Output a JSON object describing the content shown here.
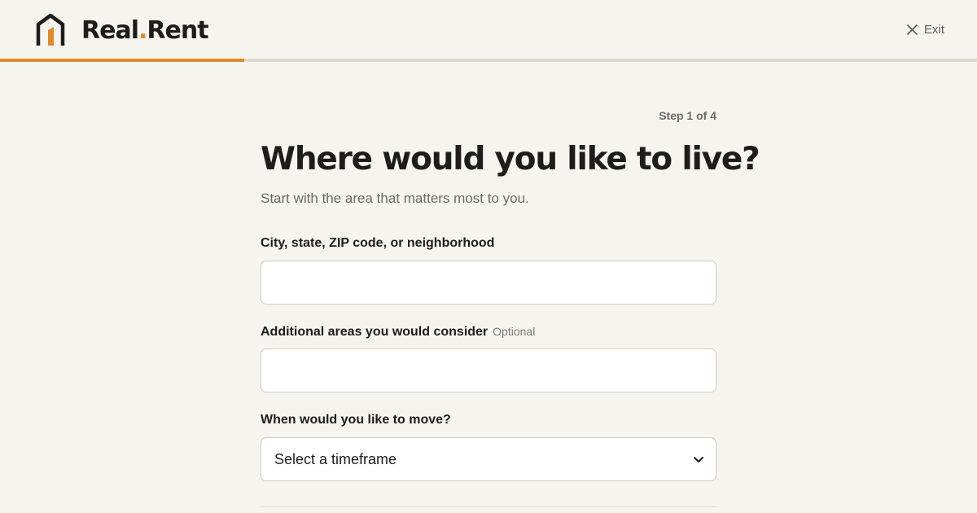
{
  "brand": {
    "name_part1": "Real",
    "name_dot": ".",
    "name_part2": "Rent",
    "accent_color": "#e08a2c"
  },
  "header": {
    "exit_label": "Exit",
    "exit_icon": "close-icon",
    "progress_fraction": 0.25
  },
  "step_indicator": "Step 1 of 4",
  "title": "Where would you like to live?",
  "subtitle": "Start with the area that matters most to you.",
  "fields": {
    "location": {
      "label": "City, state, ZIP code, or neighborhood",
      "value": "",
      "placeholder": ""
    },
    "additional_areas": {
      "label": "Additional areas you would consider",
      "optional_tag": "Optional",
      "value": "",
      "placeholder": ""
    },
    "move_timeframe": {
      "label": "When would you like to move?",
      "selected": "Select a timeframe",
      "icon": "chevron-down-icon"
    }
  }
}
